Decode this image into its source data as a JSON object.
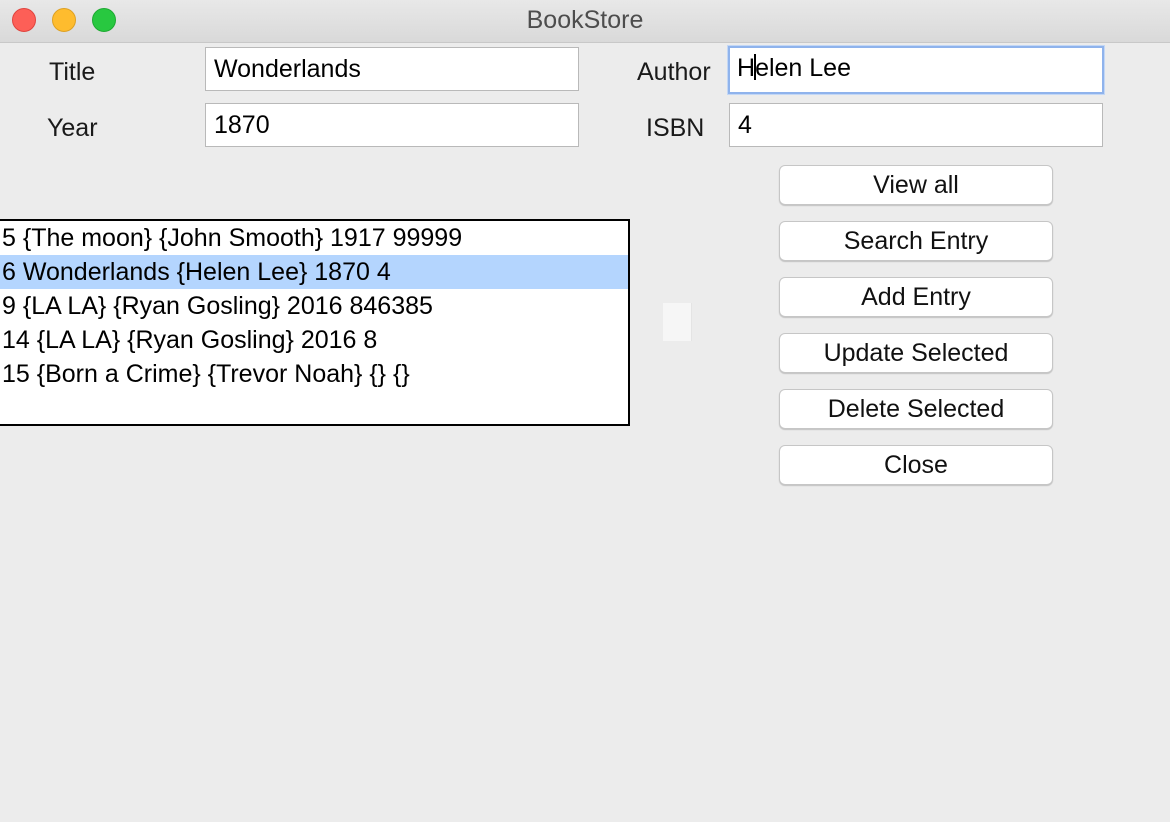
{
  "window": {
    "title": "BookStore"
  },
  "form": {
    "title_label": "Title",
    "title_value": "Wonderlands",
    "author_label": "Author",
    "author_value_before_caret": "H",
    "author_value_after_caret": "elen Lee",
    "year_label": "Year",
    "year_value": "1870",
    "isbn_label": "ISBN",
    "isbn_value": "4"
  },
  "list": {
    "rows": [
      "5 {The moon} {John Smooth} 1917 99999",
      "6 Wonderlands {Helen Lee} 1870 4",
      "9 {LA LA} {Ryan Gosling} 2016 846385",
      "14 {LA LA} {Ryan Gosling} 2016 8",
      "15 {Born a Crime} {Trevor Noah} {} {}"
    ],
    "selected_index": 1
  },
  "buttons": {
    "view_all": "View all",
    "search_entry": "Search Entry",
    "add_entry": "Add Entry",
    "update_selected": "Update Selected",
    "delete_selected": "Delete Selected",
    "close": "Close"
  },
  "colors": {
    "selection": "#b4d5fe",
    "focus_ring": "#8fb3ec",
    "window_bg": "#ececec"
  }
}
